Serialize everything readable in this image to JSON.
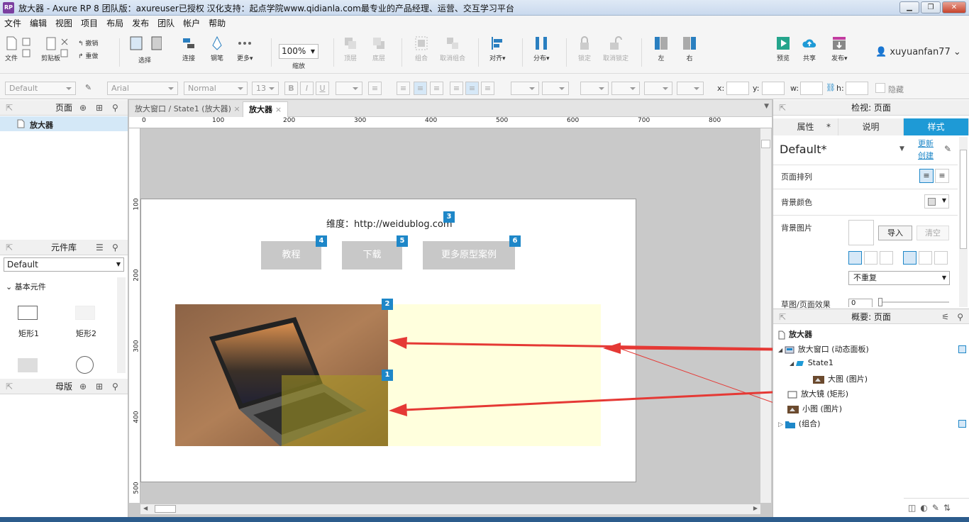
{
  "window": {
    "title": "放大器 - Axure RP 8 团队版：axureuser已授权 汉化支持：起点学院www.qidianla.com最专业的产品经理、运营、交互学习平台",
    "app_icon": "RP"
  },
  "menu": [
    "文件",
    "编辑",
    "视图",
    "项目",
    "布局",
    "发布",
    "团队",
    "帐户",
    "帮助"
  ],
  "toolbar": {
    "file": "文件",
    "clipboard": "剪贴板",
    "undo": "撤销",
    "redo": "重做",
    "select": "选择",
    "connect": "连接",
    "pen": "钢笔",
    "more": "更多▾",
    "zoom_value": "100%",
    "zoom_label": "缩放",
    "top": "顶层",
    "bottom": "底层",
    "group": "组合",
    "ungroup": "取消组合",
    "align": "对齐▾",
    "distribute": "分布▾",
    "lock": "锁定",
    "unlock": "取消锁定",
    "left": "左",
    "right": "右",
    "preview": "预览",
    "share": "共享",
    "publish": "发布▾",
    "user": "xuyuanfan77"
  },
  "format_bar": {
    "style": "Default",
    "font": "Arial",
    "weight": "Normal",
    "size": "13",
    "bold": "B",
    "italic": "I",
    "underline": "U",
    "x_label": "x:",
    "y_label": "y:",
    "w_label": "w:",
    "h_label": "h:",
    "hidden_label": "隐藏"
  },
  "pages_panel": {
    "title": "页面",
    "items": [
      "放大器"
    ]
  },
  "library_panel": {
    "title": "元件库",
    "selected": "Default",
    "group": "基本元件",
    "widgets": [
      "矩形1",
      "矩形2"
    ]
  },
  "masters_panel": {
    "title": "母版"
  },
  "tabs": [
    {
      "label": "放大窗口 / State1 (放大器)",
      "close": "×"
    },
    {
      "label": "放大器",
      "close": "×"
    }
  ],
  "ruler": {
    "h_ticks": [
      "0",
      "100",
      "200",
      "300",
      "400",
      "500",
      "600",
      "700",
      "800"
    ],
    "v_ticks": [
      "100",
      "200",
      "300",
      "400",
      "500"
    ]
  },
  "canvas": {
    "header_text": "维度：http://weidublog.com",
    "buttons": [
      "教程",
      "下载",
      "更多原型案例"
    ],
    "badges": [
      "3",
      "4",
      "5",
      "6",
      "2",
      "1"
    ]
  },
  "inspector": {
    "title": "检视: 页面",
    "tabs": [
      "属性",
      "*",
      "说明",
      "样式"
    ],
    "style_name": "Default*",
    "update_link": "更新",
    "create_link": "创建",
    "page_align_label": "页面排列",
    "bg_color_label": "背景颜色",
    "bg_image_label": "背景图片",
    "import_button": "导入",
    "clear_button": "清空",
    "repeat_select": "不重复",
    "sketch_label": "草图/页面效果",
    "sketch_value": "0"
  },
  "outline": {
    "title": "概要: 页面",
    "root": "放大器",
    "items": [
      {
        "label": "放大窗口 (动态面板)",
        "icon": "dynamic-panel-icon"
      },
      {
        "label": "State1",
        "icon": "state-icon"
      },
      {
        "label": "大图 (图片)",
        "icon": "image-icon"
      },
      {
        "label": "放大镜 (矩形)",
        "icon": "rectangle-icon"
      },
      {
        "label": "小图 (图片)",
        "icon": "image-icon"
      },
      {
        "label": "(组合)",
        "icon": "folder-icon"
      }
    ]
  },
  "colors": {
    "accent": "#1e9ad6",
    "badge": "#1e87c8",
    "arrow": "#e53935",
    "magnifier_bg": "#ffffdd"
  }
}
